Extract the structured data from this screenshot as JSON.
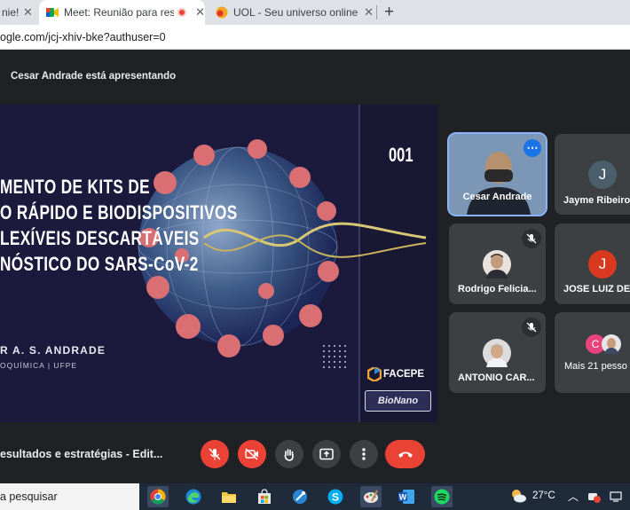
{
  "browser": {
    "tabs": [
      {
        "label": "nie!",
        "active": false
      },
      {
        "label": "Meet: Reunião para resultad",
        "active": true
      },
      {
        "label": "UOL - Seu universo online",
        "active": false
      }
    ],
    "new_tab": "+",
    "close_glyph": "✕",
    "url_text": "ogle.com/jcj-xhiv-bke?authuser=0"
  },
  "meet": {
    "presenter_text": "Cesar Andrade está apresentando",
    "slide": {
      "number": "001",
      "title_lines": [
        "MENTO DE KITS DE",
        "O RÁPIDO E BIODISPOSITIVOS",
        "LEXÍVEIS DESCARTÁVEIS",
        "NÓSTICO DO SARS-CoV-2"
      ],
      "author": "R A. S. ANDRADE",
      "affiliation": "OQUÍMICA | UFPE",
      "logo_facepe": "FACEPE",
      "logo_bionano": "BioNano"
    },
    "participants": [
      {
        "name": "Cesar Andrade",
        "type": "video",
        "muted": false,
        "highlight": true
      },
      {
        "name": "Jayme Ribeiro",
        "initial": "J",
        "avatar_color": "#4a5f6b",
        "muted": false
      },
      {
        "name": "Rodrigo Felicia...",
        "type": "photo",
        "muted": true
      },
      {
        "name": "JOSE LUIZ DE",
        "initial": "J",
        "avatar_color": "#d93a1f",
        "muted": false
      },
      {
        "name": "ANTONIO CAR...",
        "type": "photo",
        "muted": true
      },
      {
        "name": "Mais 21 pesso",
        "initial": "C",
        "avatar_color": "#e8437a",
        "muted": false
      }
    ],
    "meeting_title": "esultados e estratégias - Edit...",
    "controls": [
      "mic-off",
      "camera-off",
      "raise-hand",
      "present",
      "more",
      "end-call"
    ]
  },
  "taskbar": {
    "search_placeholder": "a pesquisar",
    "apps": [
      "chrome",
      "edge",
      "file-explorer",
      "store",
      "unknown-blue",
      "skype",
      "paint",
      "word",
      "spotify"
    ],
    "temperature": "27°C"
  },
  "colors": {
    "meet_bg": "#202124",
    "tile_bg": "#3c4043",
    "end_call": "#ea4335",
    "active_outline": "#8ab4f8"
  }
}
